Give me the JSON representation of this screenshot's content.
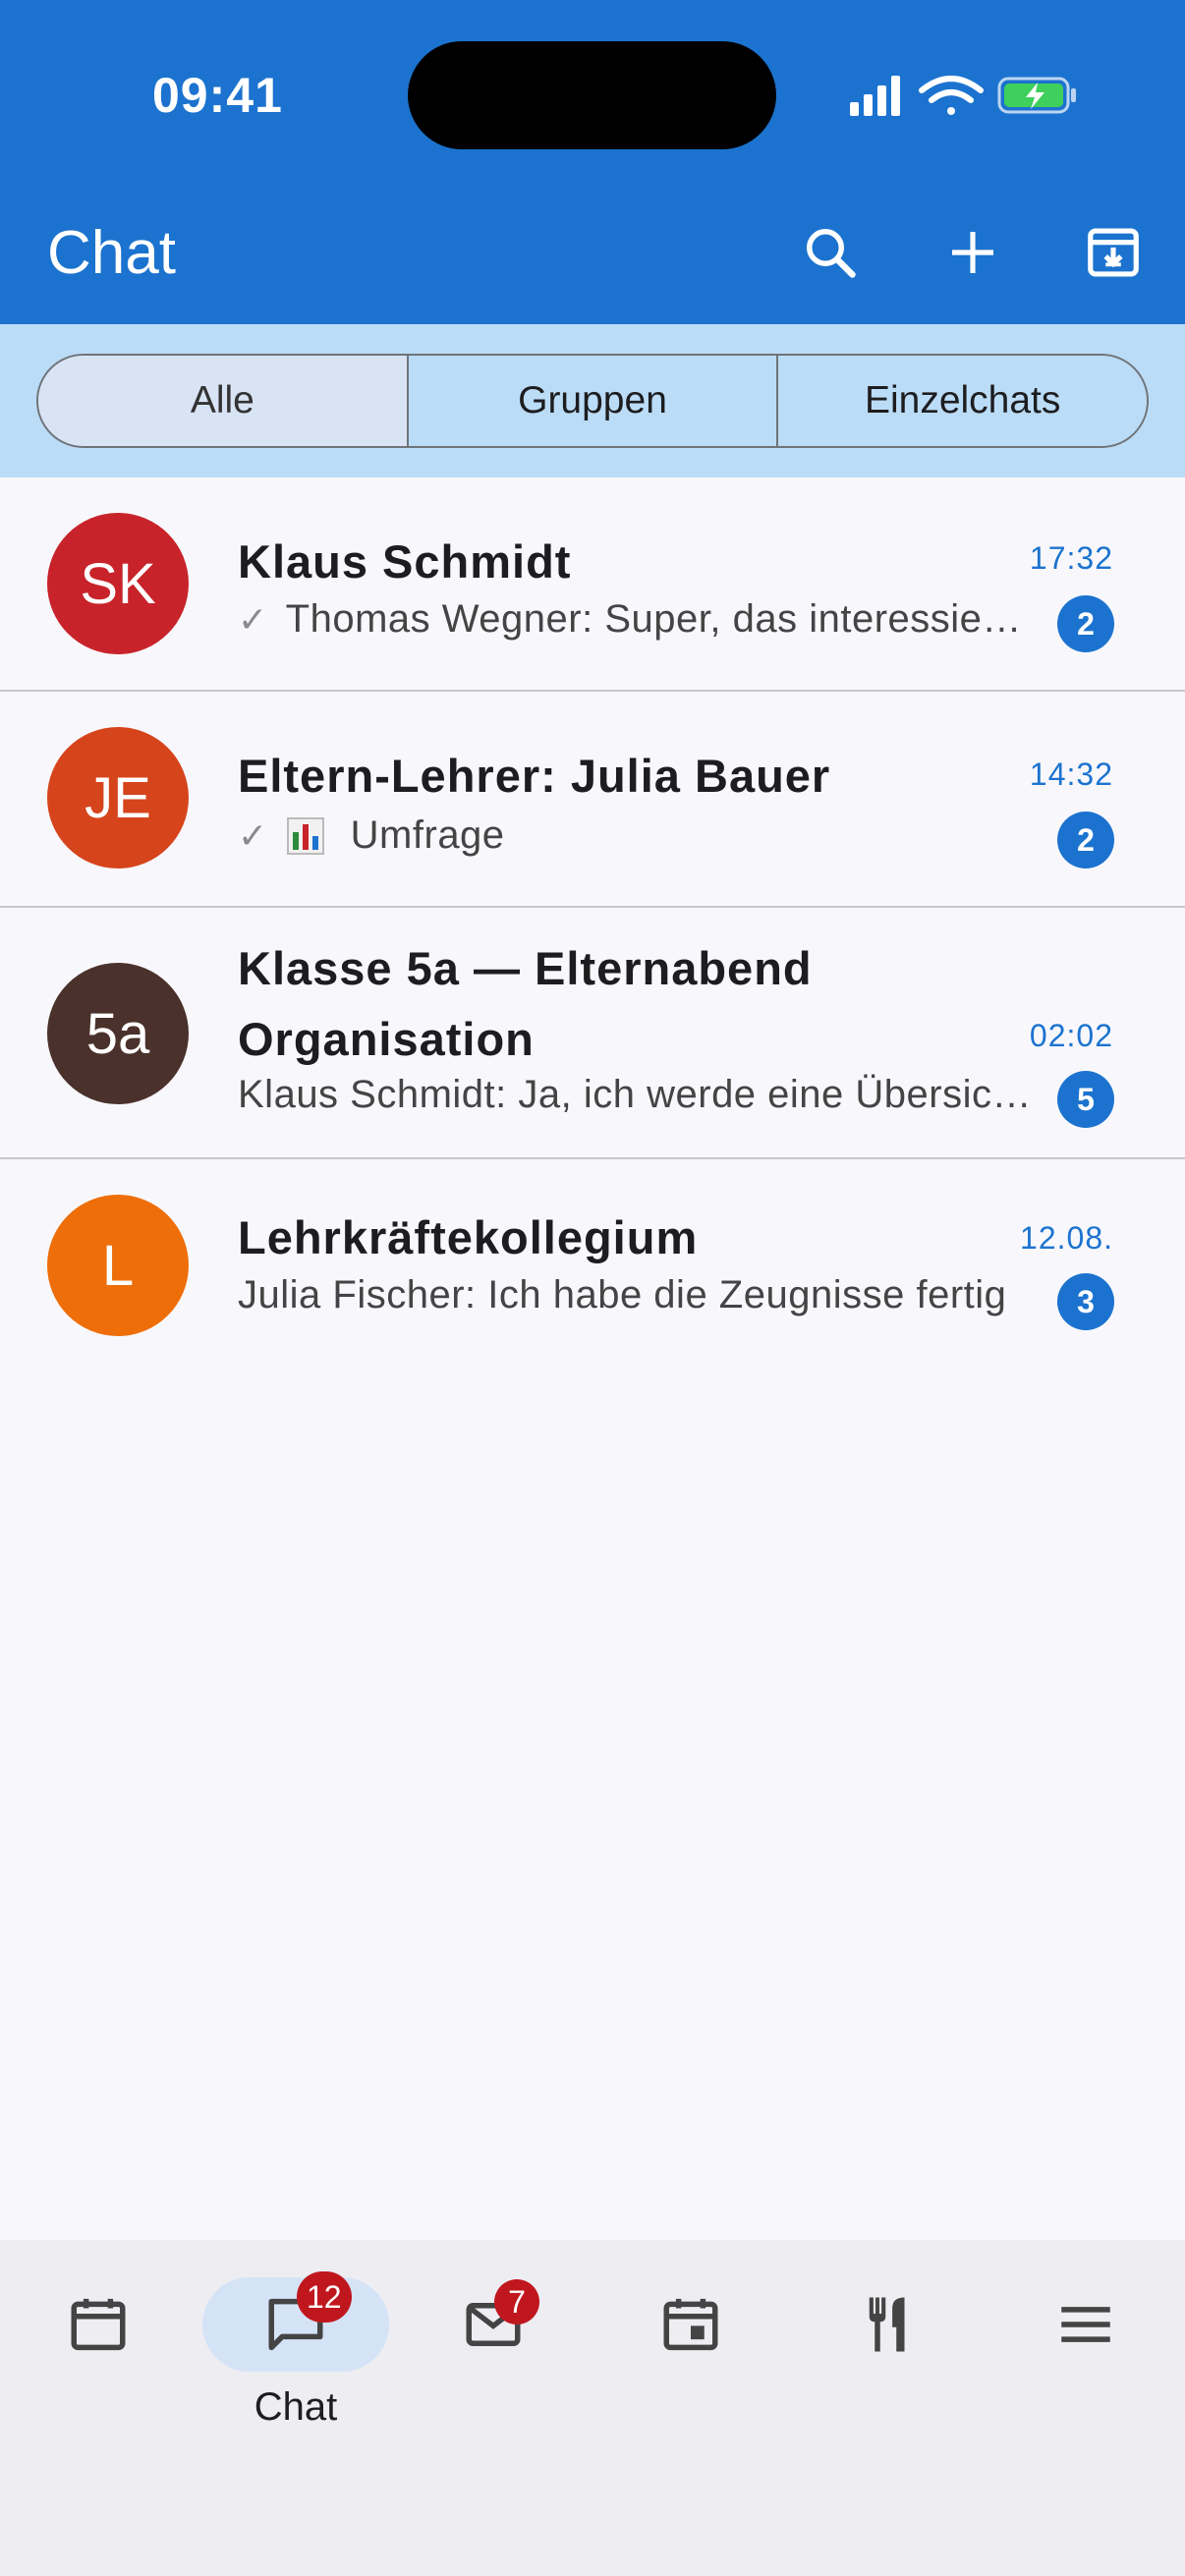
{
  "status": {
    "time": "09:41"
  },
  "header": {
    "title": "Chat"
  },
  "filters": {
    "all": "Alle",
    "groups": "Gruppen",
    "single": "Einzelchats"
  },
  "chats": [
    {
      "initials": "SK",
      "avatar_color": "#c8232a",
      "name": "Klaus Schmidt",
      "preview": "Thomas Wegner: Super, das interessiert mich!",
      "time": "17:32",
      "unread": "2"
    },
    {
      "initials": "JE",
      "avatar_color": "#d6441c",
      "name": "Eltern-Lehrer: Julia Bauer",
      "preview": "Umfrage",
      "time": "14:32",
      "unread": "2"
    },
    {
      "initials": "5a",
      "avatar_color": "#4b312b",
      "name": "Klasse 5a — Elternabend Organisation",
      "preview": "Klaus Schmidt: Ja, ich werde eine Übersicht erstellen",
      "time": "02:02",
      "unread": "5"
    },
    {
      "initials": "L",
      "avatar_color": "#ee6e0a",
      "name": "Lehrkräftekollegium",
      "preview": "Julia Fischer: Ich habe die Zeugnisse fertig",
      "time": "12.08.",
      "unread": "3"
    }
  ],
  "nav": {
    "chat_label": "Chat",
    "chat_badge": "12",
    "mail_badge": "7"
  },
  "colors": {
    "primary": "#1c73cf",
    "filter_bg": "#bbdcf7",
    "badge_red": "#c0171e"
  }
}
